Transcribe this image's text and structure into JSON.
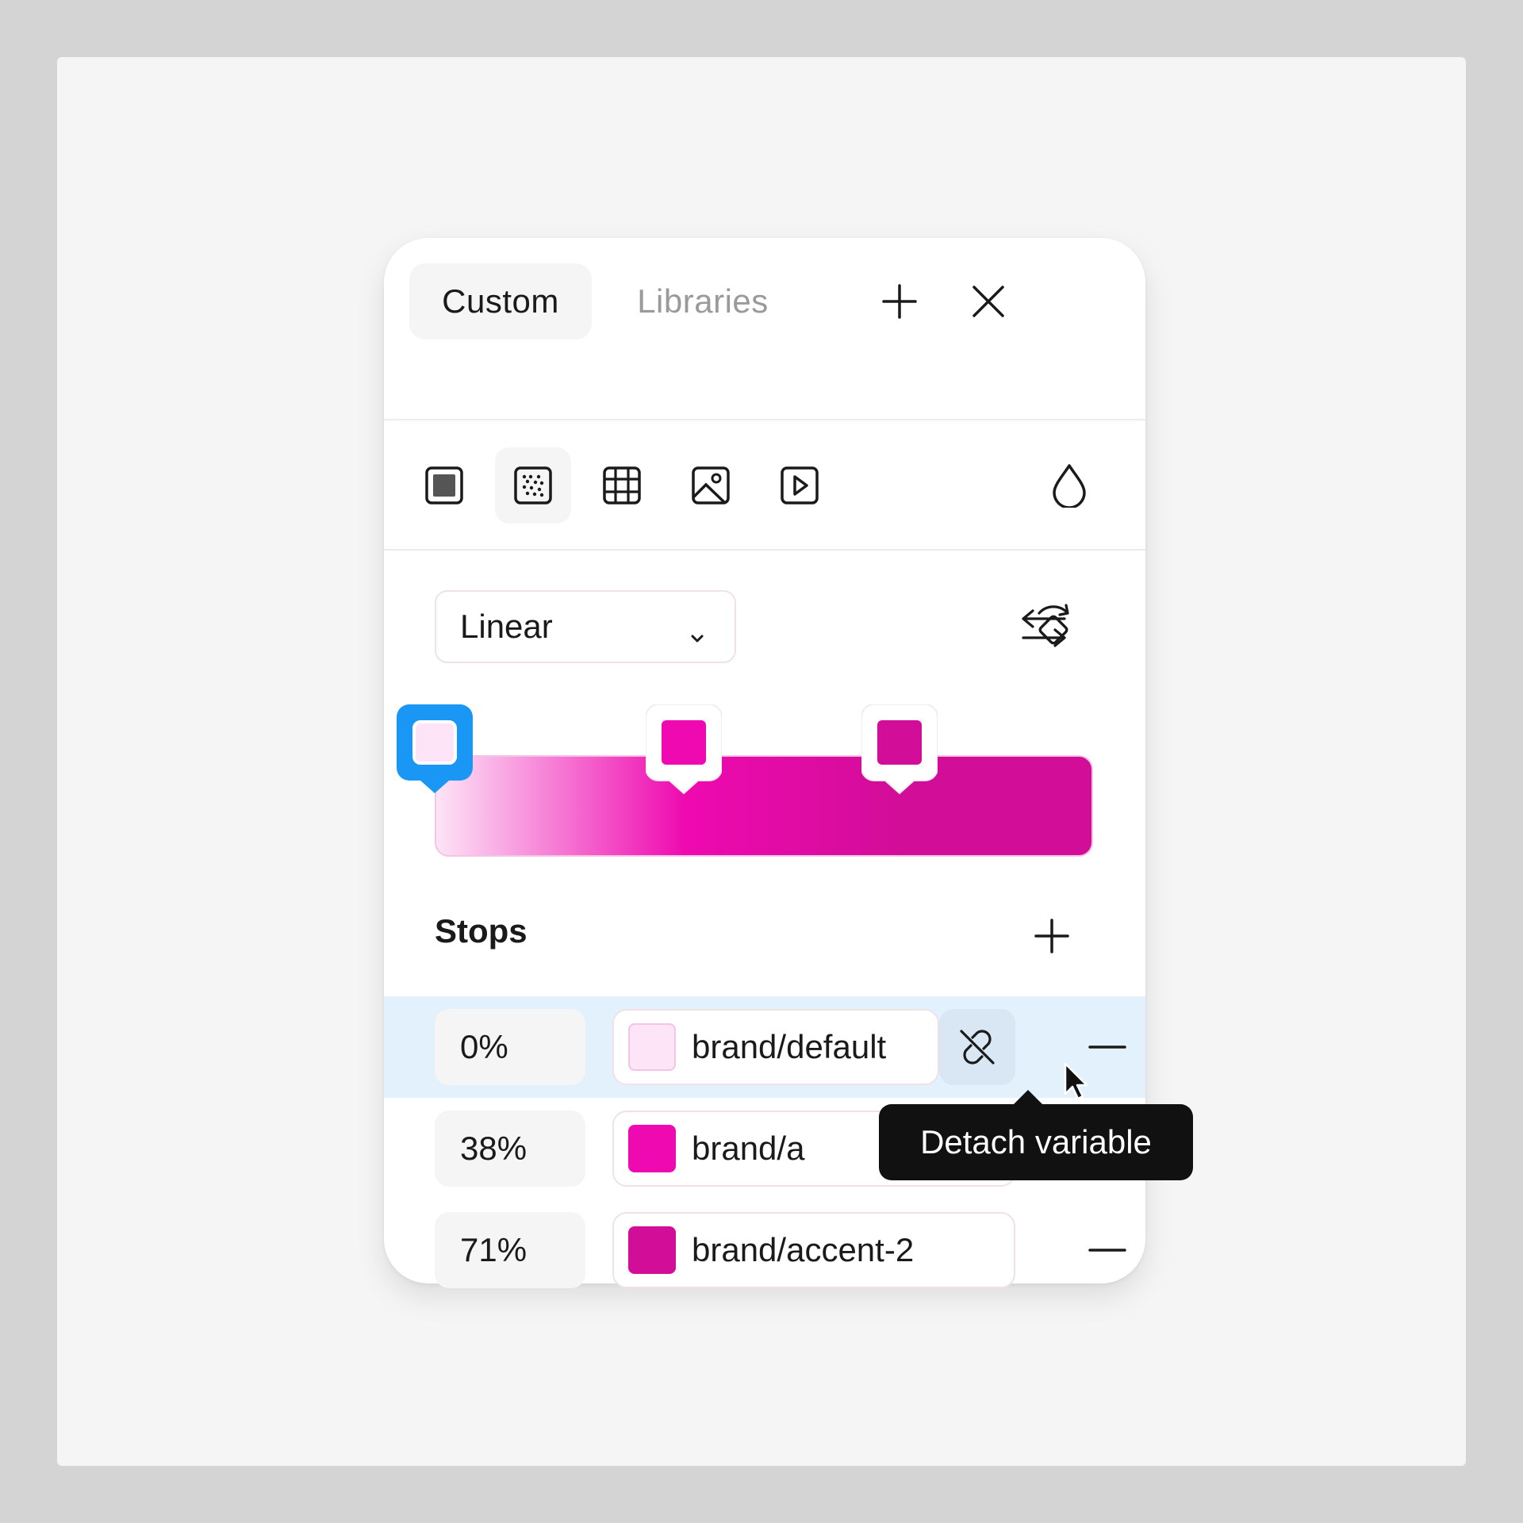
{
  "tabs": {
    "custom": "Custom",
    "libraries": "Libraries"
  },
  "fill_types": [
    "solid-icon",
    "gradient-icon",
    "pattern-icon",
    "image-icon",
    "video-icon"
  ],
  "gradient": {
    "type_label": "Linear",
    "colors": {
      "default": "#fde4f6",
      "accent": "#ee0ab0",
      "accent_2": "#d20d98"
    }
  },
  "stops_label": "Stops",
  "stops": [
    {
      "position": "0%",
      "variable": "brand/default",
      "color": "#fde4f6",
      "selected": true
    },
    {
      "position": "38%",
      "variable": "brand/a",
      "color": "#ee0ab0"
    },
    {
      "position": "71%",
      "variable": "brand/accent-2",
      "color": "#d20d98"
    }
  ],
  "tooltip": "Detach variable",
  "colors": {
    "selection": "#1a97f5",
    "tooltip_bg": "#111111"
  }
}
